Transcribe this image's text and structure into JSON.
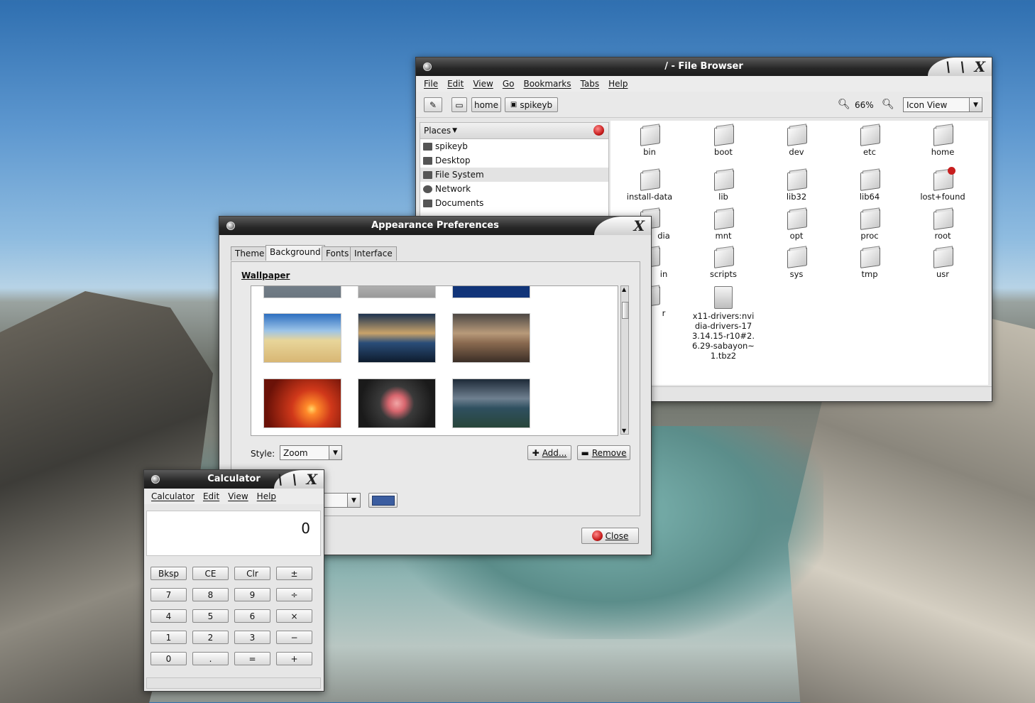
{
  "colors": {
    "title_dark": "#262626",
    "window_bg": "#e6e6e6",
    "close_red": "#c81e1e",
    "swatch_blue": "#3b5da0"
  },
  "file_browser": {
    "title": "/ - File Browser",
    "menu": [
      "File",
      "Edit",
      "View",
      "Go",
      "Bookmarks",
      "Tabs",
      "Help"
    ],
    "path_buttons": [
      "home",
      "spikeyb"
    ],
    "zoom_label": "66%",
    "view_mode": "Icon View",
    "places_label": "Places",
    "places": [
      {
        "label": "spikeyb",
        "icon": "home-folder-icon"
      },
      {
        "label": "Desktop",
        "icon": "desktop-icon"
      },
      {
        "label": "File System",
        "icon": "drive-icon"
      },
      {
        "label": "Network",
        "icon": "network-icon"
      },
      {
        "label": "Documents",
        "icon": "folder-icon"
      }
    ],
    "folders": [
      [
        "bin",
        "boot",
        "dev",
        "etc",
        "home"
      ],
      [
        "install-data",
        "lib",
        "lib32",
        "lib64",
        "lost+found"
      ],
      [
        "dia",
        "mnt",
        "opt",
        "proc",
        "root"
      ],
      [
        "in",
        "scripts",
        "sys",
        "tmp",
        "usr"
      ],
      [
        "r",
        "x11-drivers:nvidia-drivers-173.14.15-r10#2.6.29-sabayon~1.tbz2"
      ]
    ]
  },
  "appearance": {
    "title": "Appearance Preferences",
    "tabs": [
      "Theme",
      "Background",
      "Fonts",
      "Interface"
    ],
    "selected_tab": "Background",
    "section_label": "Wallpaper",
    "style_label": "Style:",
    "style_value": "Zoom",
    "add_label": "Add...",
    "remove_label": "Remove",
    "close_label": "Close"
  },
  "calculator": {
    "title": "Calculator",
    "menu": [
      "Calculator",
      "Edit",
      "View",
      "Help"
    ],
    "display": "0",
    "keys": [
      [
        "Bksp",
        "CE",
        "Clr",
        "±"
      ],
      [
        "7",
        "8",
        "9",
        "÷"
      ],
      [
        "4",
        "5",
        "6",
        "×"
      ],
      [
        "1",
        "2",
        "3",
        "−"
      ],
      [
        "0",
        ".",
        "=",
        "+"
      ]
    ]
  }
}
